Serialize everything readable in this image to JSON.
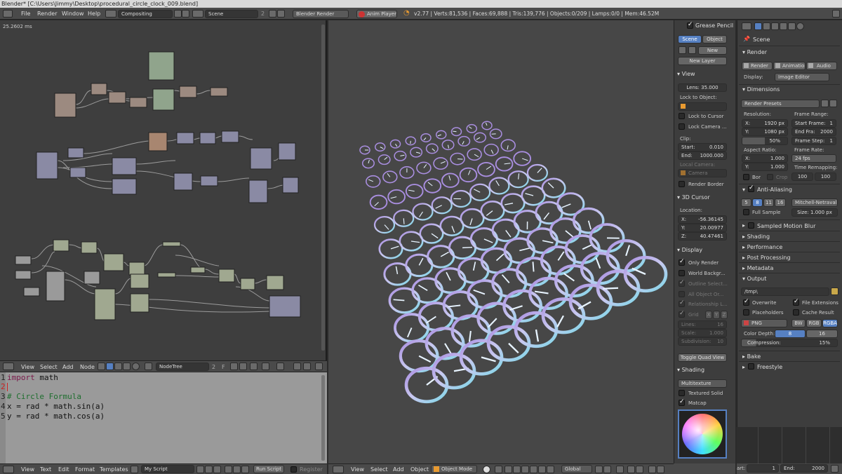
{
  "window_title": "Blender* [C:\\Users\\Jimmy\\Desktop\\procedural_circle_clock_009.blend]",
  "topbar": {
    "menus": [
      "File",
      "Render",
      "Window",
      "Help"
    ],
    "layout": "Compositing",
    "scene": "Scene",
    "scene_users": "2",
    "engine": "Blender Render",
    "anim_player": "Anim Player",
    "stats": "v2.77 | Verts:81,536 | Faces:69,888 | Tris:139,776 | Objects:0/209 | Lamps:0/0 | Mem:46.52M"
  },
  "node_editor": {
    "timing": "25.2602 ms",
    "menus": [
      "View",
      "Select",
      "Add",
      "Node"
    ],
    "tree_name": "NodeTree",
    "tree_users": "2",
    "tree_flag": "F"
  },
  "text_editor": {
    "lines": [
      {
        "num": "1",
        "text": "import math",
        "kind": "code"
      },
      {
        "num": "2",
        "text": "",
        "kind": "cursor"
      },
      {
        "num": "3",
        "text": "# Circle Formula",
        "kind": "comment"
      },
      {
        "num": "4",
        "text": "x = rad * math.sin(a)",
        "kind": "code"
      },
      {
        "num": "5",
        "text": "y = rad * math.cos(a)",
        "kind": "code"
      }
    ],
    "menus": [
      "View",
      "Text",
      "Edit",
      "Format",
      "Templates"
    ],
    "script_name": "My Script",
    "run_script": "Run Script",
    "register": "Register"
  },
  "viewport": {
    "menus": [
      "View",
      "Select",
      "Add",
      "Object"
    ],
    "mode": "Object Mode",
    "orientation": "Global",
    "clock_rows": 11,
    "clock_cols": 9
  },
  "n_panel": {
    "grease_pencil": "Grease Pencil",
    "scene_btn": "Scene",
    "object_btn": "Object",
    "new_btn": "New",
    "new_layer": "New Layer",
    "view_hdr": "View",
    "lens": "Lens:",
    "lens_val": "35.000",
    "lock_to_object": "Lock to Object:",
    "lock_to_cursor": "Lock to Cursor",
    "lock_camera": "Lock Camera ...",
    "clip": "Clip:",
    "clip_start": "Start:",
    "clip_start_val": "0.010",
    "clip_end": "End:",
    "clip_end_val": "1000.000",
    "local_camera": "Local Camera:",
    "camera": "Camera",
    "render_border": "Render Border",
    "cursor_hdr": "3D Cursor",
    "location": "Location:",
    "cx": "X:",
    "cx_val": "-56.36145",
    "cy": "Y:",
    "cy_val": "20.00977",
    "cz": "Z:",
    "cz_val": "40.47461",
    "display_hdr": "Display",
    "only_render": "Only Render",
    "world_bg": "World Backgr...",
    "outline_sel": "Outline Select...",
    "all_obj_origins": "All Object Or...",
    "relationship": "Relationship L...",
    "grid": "Grid",
    "gx": "X",
    "gy": "Y",
    "gz": "Z",
    "lines": "Lines:",
    "lines_val": "16",
    "scale": "Scale:",
    "scale_val": "1.000",
    "subdivision": "Subdivision:",
    "subdivision_val": "10",
    "toggle_quad": "Toggle Quad View",
    "shading_hdr": "Shading",
    "shading_mode": "Multitexture",
    "textured_solid": "Textured Solid",
    "matcap": "Matcap"
  },
  "properties": {
    "scene": "Scene",
    "render_hdr": "Render",
    "render_btn": "Render",
    "animation_btn": "Animation",
    "audio_btn": "Audio",
    "display": "Display:",
    "display_val": "Image Editor",
    "dimensions_hdr": "Dimensions",
    "render_presets": "Render Presets",
    "resolution": "Resolution:",
    "res_x": "X:",
    "res_x_val": "1920 px",
    "res_y": "Y:",
    "res_y_val": "1080 px",
    "res_pct": "50%",
    "frame_range": "Frame Range:",
    "start_frame": "Start Frame:",
    "start_frame_val": "1",
    "end_frame": "End Fra:",
    "end_frame_val": "2000",
    "frame_step": "Frame Step:",
    "frame_step_val": "1",
    "aspect_ratio": "Aspect Ratio:",
    "asp_x": "X:",
    "asp_x_val": "1.000",
    "asp_y": "Y:",
    "asp_y_val": "1.000",
    "frame_rate": "Frame Rate:",
    "fps": "24 fps",
    "time_remap": "Time Remapping:",
    "remap_old": "100",
    "remap_new": "100",
    "bor": "Bor",
    "crop": "Crop",
    "aa_hdr": "Anti-Aliasing",
    "aa_samples": [
      "5",
      "8",
      "11",
      "16"
    ],
    "aa_filter": "Mitchell-Netravali",
    "full_sample": "Full Sample",
    "aa_size": "Size: 1.000 px",
    "motion_blur": "Sampled Motion Blur",
    "shading_hdr": "Shading",
    "performance_hdr": "Performance",
    "post_processing_hdr": "Post Processing",
    "metadata_hdr": "Metadata",
    "output_hdr": "Output",
    "output_path": "/tmp\\",
    "overwrite": "Overwrite",
    "file_extensions": "File Extensions",
    "placeholders": "Placeholders",
    "cache_result": "Cache Result",
    "format": "PNG",
    "bw": "BW",
    "rgb": "RGB",
    "rgba": "RGBA",
    "color_depth": "Color Depth:",
    "depth_8": "8",
    "depth_16": "16",
    "compression": "Compression:",
    "compression_val": "15%",
    "bake_hdr": "Bake",
    "freestyle_hdr": "Freestyle"
  },
  "timeline": {
    "start": "art:",
    "start_val": "1",
    "end": "End:",
    "end_val": "2000"
  },
  "colors": {
    "accent_blue": "#5680c2",
    "clock_cyan": "#7fd8e8",
    "clock_purple": "#a98ee0"
  }
}
